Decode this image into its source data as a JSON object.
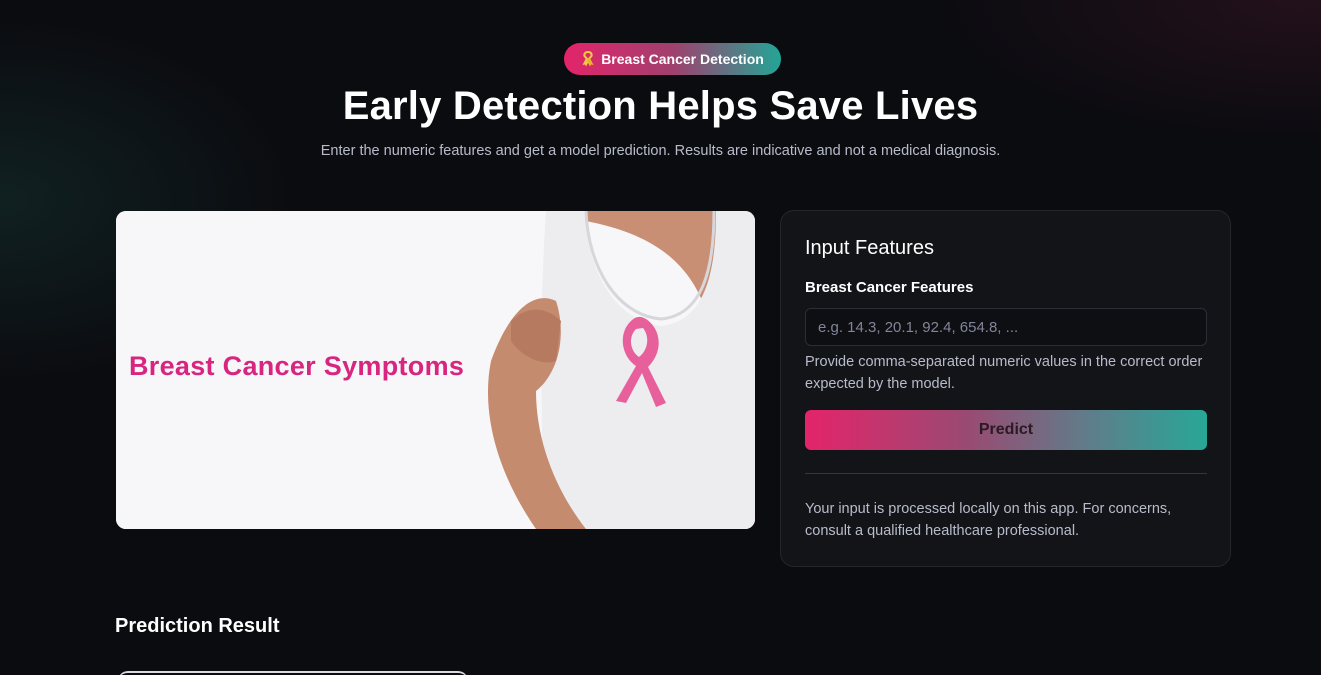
{
  "header": {
    "badge_icon": "ribbon-icon",
    "badge_label": "Breast Cancer Detection",
    "title": "Early Detection Helps Save Lives",
    "subtitle": "Enter the numeric features and get a model prediction. Results are indicative and not a medical diagnosis."
  },
  "hero_image": {
    "caption": "Breast Cancer Symptoms"
  },
  "form": {
    "title": "Input Features",
    "field_label": "Breast Cancer Features",
    "placeholder": "e.g. 14.3, 20.1, 92.4, 654.8, ...",
    "value": "",
    "hint": "Provide comma-separated numeric values in the correct order expected by the model.",
    "button_label": "Predict",
    "privacy_note": "Your input is processed locally on this app. For concerns, consult a qualified healthcare professional."
  },
  "result": {
    "heading": "Prediction Result"
  },
  "colors": {
    "accent_pink": "#e4246a",
    "accent_teal": "#27a797",
    "background": "#0b0c10",
    "panel": "#131418"
  }
}
